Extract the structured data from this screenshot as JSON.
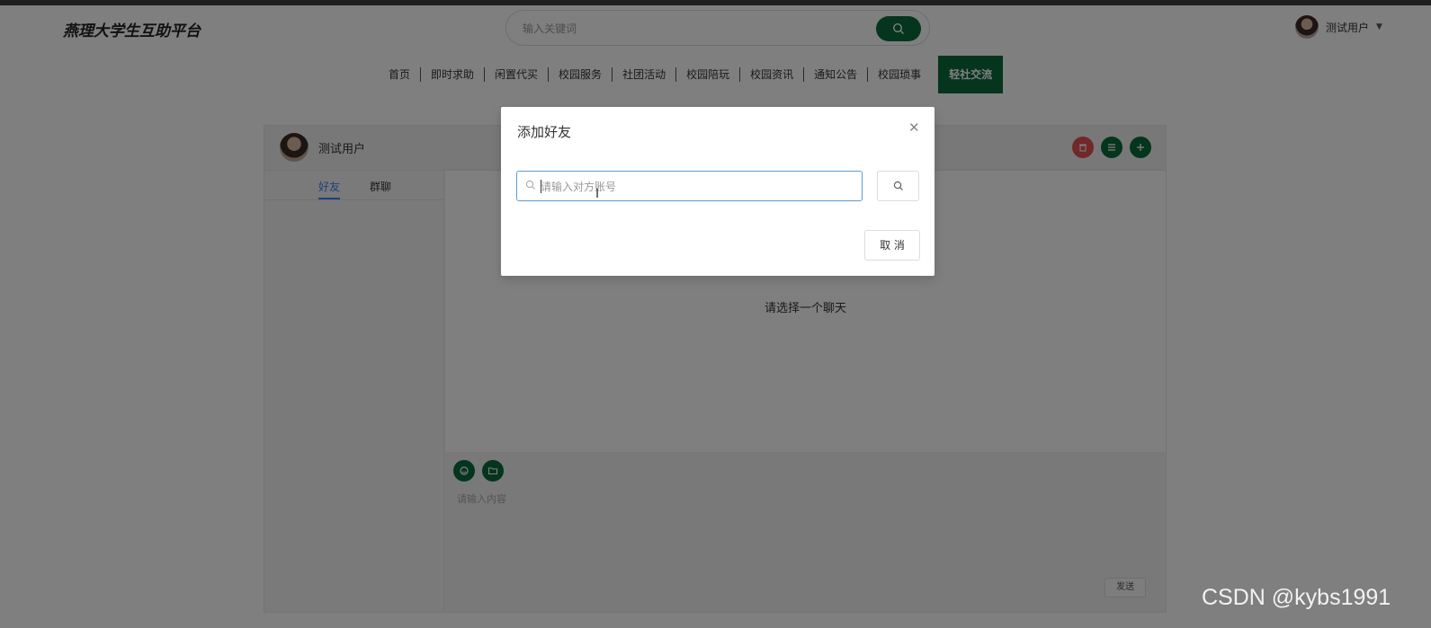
{
  "brand": "燕理大学生互助平台",
  "search": {
    "placeholder": "输入关键词"
  },
  "user": {
    "name": "测试用户"
  },
  "nav": {
    "items": [
      "首页",
      "即时求助",
      "闲置代买",
      "校园服务",
      "社团活动",
      "校园陪玩",
      "校园资讯",
      "通知公告",
      "校园琐事"
    ],
    "active": "轻社交流"
  },
  "chat": {
    "username": "测试用户",
    "tabs": [
      "好友",
      "群聊"
    ],
    "empty_hint": "请选择一个聊天",
    "composer_placeholder": "请输入内容",
    "send_label": "发送"
  },
  "modal": {
    "title": "添加好友",
    "input_placeholder": "请输入对方账号",
    "cancel_label": "取 消"
  },
  "watermark": "CSDN @kybs1991",
  "colors": {
    "brand_green": "#0a6b3a",
    "danger_red": "#e05050",
    "active_tab_blue": "#3b82f6"
  }
}
